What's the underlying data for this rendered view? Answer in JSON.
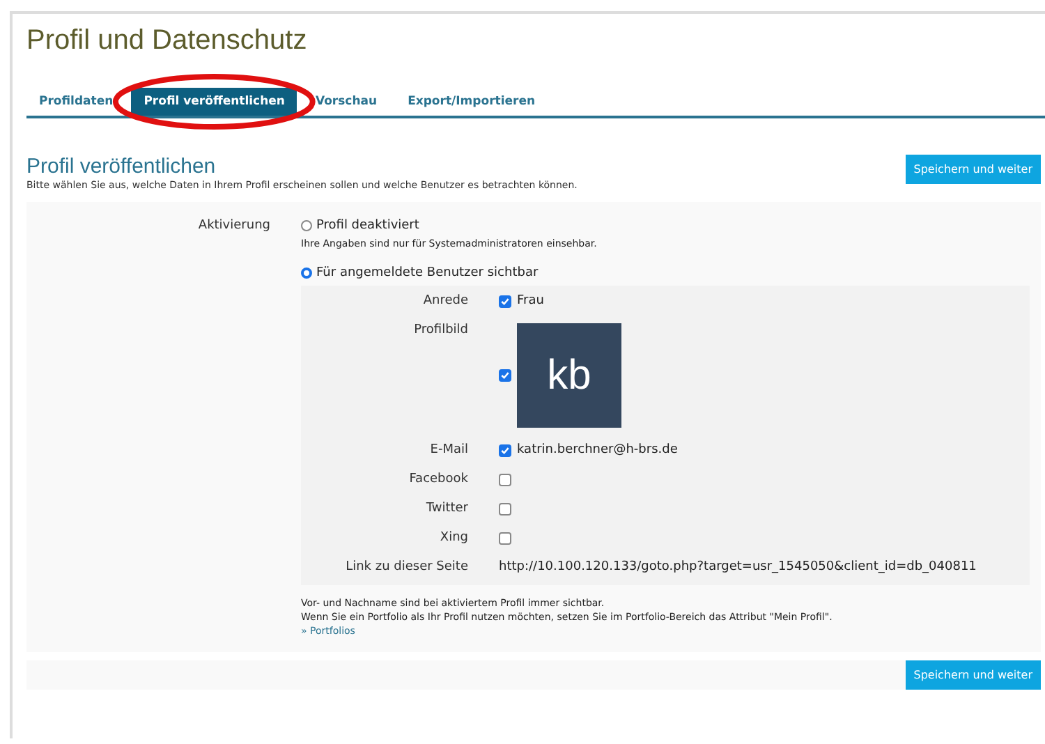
{
  "page_title": "Profil und Datenschutz",
  "tabs": [
    {
      "label": "Profildaten",
      "selected": false,
      "circled": false
    },
    {
      "label": "Profil veröffentlichen",
      "selected": true,
      "circled": true
    },
    {
      "label": "Vorschau",
      "selected": false,
      "circled": false
    },
    {
      "label": "Export/Importieren",
      "selected": false,
      "circled": false
    }
  ],
  "section": {
    "title": "Profil veröffentlichen",
    "description": "Bitte wählen Sie aus, welche Daten in Ihrem Profil erscheinen sollen und welche Benutzer es betrachten können.",
    "save_button": "Speichern und weiter"
  },
  "activation": {
    "label": "Aktivierung",
    "options": [
      {
        "label": "Profil deaktiviert",
        "selected": false,
        "hint": "Ihre Angaben sind nur für Systemadministratoren einsehbar."
      },
      {
        "label": "Für angemeldete Benutzer sichtbar",
        "selected": true
      }
    ]
  },
  "fields": [
    {
      "kind": "checkbox",
      "label": "Anrede",
      "checked": true,
      "value": "Frau"
    },
    {
      "kind": "avatar",
      "label": "Profilbild",
      "checked": true,
      "value": "kb"
    },
    {
      "kind": "checkbox",
      "label": "E-Mail",
      "checked": true,
      "value": "katrin.berchner@h-brs.de"
    },
    {
      "kind": "checkbox",
      "label": "Facebook",
      "checked": false
    },
    {
      "kind": "checkbox",
      "label": "Twitter",
      "checked": false
    },
    {
      "kind": "checkbox",
      "label": "Xing",
      "checked": false
    },
    {
      "kind": "plain",
      "label": "Link zu dieser Seite",
      "value": "http://10.100.120.133/goto.php?target=usr_1545050&client_id=db_040811"
    }
  ],
  "notes": [
    "Vor- und Nachname sind bei aktiviertem Profil immer sichtbar.",
    "Wenn Sie ein Portfolio als Ihr Profil nutzen möchten, setzen Sie im Portfolio-Bereich das Attribut \"Mein Profil\"."
  ],
  "portfolio_link": "» Portfolios",
  "bottom_button": "Speichern und weiter"
}
